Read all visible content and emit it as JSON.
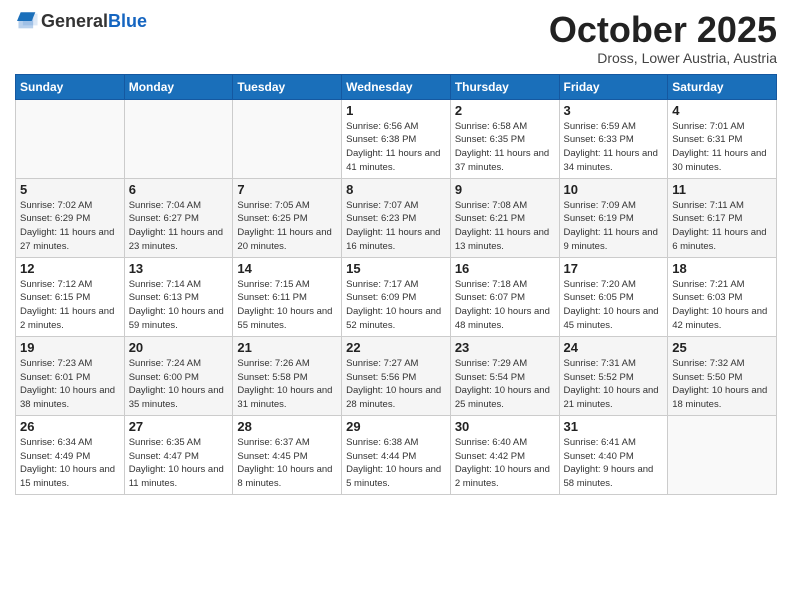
{
  "header": {
    "logo_general": "General",
    "logo_blue": "Blue",
    "month_title": "October 2025",
    "location": "Dross, Lower Austria, Austria"
  },
  "days_of_week": [
    "Sunday",
    "Monday",
    "Tuesday",
    "Wednesday",
    "Thursday",
    "Friday",
    "Saturday"
  ],
  "weeks": [
    [
      {
        "day": "",
        "info": ""
      },
      {
        "day": "",
        "info": ""
      },
      {
        "day": "",
        "info": ""
      },
      {
        "day": "1",
        "info": "Sunrise: 6:56 AM\nSunset: 6:38 PM\nDaylight: 11 hours\nand 41 minutes."
      },
      {
        "day": "2",
        "info": "Sunrise: 6:58 AM\nSunset: 6:35 PM\nDaylight: 11 hours\nand 37 minutes."
      },
      {
        "day": "3",
        "info": "Sunrise: 6:59 AM\nSunset: 6:33 PM\nDaylight: 11 hours\nand 34 minutes."
      },
      {
        "day": "4",
        "info": "Sunrise: 7:01 AM\nSunset: 6:31 PM\nDaylight: 11 hours\nand 30 minutes."
      }
    ],
    [
      {
        "day": "5",
        "info": "Sunrise: 7:02 AM\nSunset: 6:29 PM\nDaylight: 11 hours\nand 27 minutes."
      },
      {
        "day": "6",
        "info": "Sunrise: 7:04 AM\nSunset: 6:27 PM\nDaylight: 11 hours\nand 23 minutes."
      },
      {
        "day": "7",
        "info": "Sunrise: 7:05 AM\nSunset: 6:25 PM\nDaylight: 11 hours\nand 20 minutes."
      },
      {
        "day": "8",
        "info": "Sunrise: 7:07 AM\nSunset: 6:23 PM\nDaylight: 11 hours\nand 16 minutes."
      },
      {
        "day": "9",
        "info": "Sunrise: 7:08 AM\nSunset: 6:21 PM\nDaylight: 11 hours\nand 13 minutes."
      },
      {
        "day": "10",
        "info": "Sunrise: 7:09 AM\nSunset: 6:19 PM\nDaylight: 11 hours\nand 9 minutes."
      },
      {
        "day": "11",
        "info": "Sunrise: 7:11 AM\nSunset: 6:17 PM\nDaylight: 11 hours\nand 6 minutes."
      }
    ],
    [
      {
        "day": "12",
        "info": "Sunrise: 7:12 AM\nSunset: 6:15 PM\nDaylight: 11 hours\nand 2 minutes."
      },
      {
        "day": "13",
        "info": "Sunrise: 7:14 AM\nSunset: 6:13 PM\nDaylight: 10 hours\nand 59 minutes."
      },
      {
        "day": "14",
        "info": "Sunrise: 7:15 AM\nSunset: 6:11 PM\nDaylight: 10 hours\nand 55 minutes."
      },
      {
        "day": "15",
        "info": "Sunrise: 7:17 AM\nSunset: 6:09 PM\nDaylight: 10 hours\nand 52 minutes."
      },
      {
        "day": "16",
        "info": "Sunrise: 7:18 AM\nSunset: 6:07 PM\nDaylight: 10 hours\nand 48 minutes."
      },
      {
        "day": "17",
        "info": "Sunrise: 7:20 AM\nSunset: 6:05 PM\nDaylight: 10 hours\nand 45 minutes."
      },
      {
        "day": "18",
        "info": "Sunrise: 7:21 AM\nSunset: 6:03 PM\nDaylight: 10 hours\nand 42 minutes."
      }
    ],
    [
      {
        "day": "19",
        "info": "Sunrise: 7:23 AM\nSunset: 6:01 PM\nDaylight: 10 hours\nand 38 minutes."
      },
      {
        "day": "20",
        "info": "Sunrise: 7:24 AM\nSunset: 6:00 PM\nDaylight: 10 hours\nand 35 minutes."
      },
      {
        "day": "21",
        "info": "Sunrise: 7:26 AM\nSunset: 5:58 PM\nDaylight: 10 hours\nand 31 minutes."
      },
      {
        "day": "22",
        "info": "Sunrise: 7:27 AM\nSunset: 5:56 PM\nDaylight: 10 hours\nand 28 minutes."
      },
      {
        "day": "23",
        "info": "Sunrise: 7:29 AM\nSunset: 5:54 PM\nDaylight: 10 hours\nand 25 minutes."
      },
      {
        "day": "24",
        "info": "Sunrise: 7:31 AM\nSunset: 5:52 PM\nDaylight: 10 hours\nand 21 minutes."
      },
      {
        "day": "25",
        "info": "Sunrise: 7:32 AM\nSunset: 5:50 PM\nDaylight: 10 hours\nand 18 minutes."
      }
    ],
    [
      {
        "day": "26",
        "info": "Sunrise: 6:34 AM\nSunset: 4:49 PM\nDaylight: 10 hours\nand 15 minutes."
      },
      {
        "day": "27",
        "info": "Sunrise: 6:35 AM\nSunset: 4:47 PM\nDaylight: 10 hours\nand 11 minutes."
      },
      {
        "day": "28",
        "info": "Sunrise: 6:37 AM\nSunset: 4:45 PM\nDaylight: 10 hours\nand 8 minutes."
      },
      {
        "day": "29",
        "info": "Sunrise: 6:38 AM\nSunset: 4:44 PM\nDaylight: 10 hours\nand 5 minutes."
      },
      {
        "day": "30",
        "info": "Sunrise: 6:40 AM\nSunset: 4:42 PM\nDaylight: 10 hours\nand 2 minutes."
      },
      {
        "day": "31",
        "info": "Sunrise: 6:41 AM\nSunset: 4:40 PM\nDaylight: 9 hours\nand 58 minutes."
      },
      {
        "day": "",
        "info": ""
      }
    ]
  ]
}
